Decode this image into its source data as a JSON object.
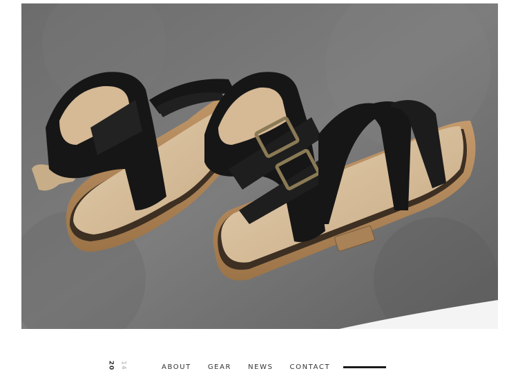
{
  "nav": {
    "year_main": "20",
    "year_sub": "14",
    "links": [
      "ABOUT",
      "GEAR",
      "NEWS",
      "CONTACT"
    ]
  },
  "photo": {
    "subject": "sandals-photo",
    "colors": {
      "background": "#6f6f6f",
      "strap": "#161616",
      "insole": "#d9bf9c",
      "sole": "#b38a5f",
      "buckle": "#8a7a55"
    }
  }
}
